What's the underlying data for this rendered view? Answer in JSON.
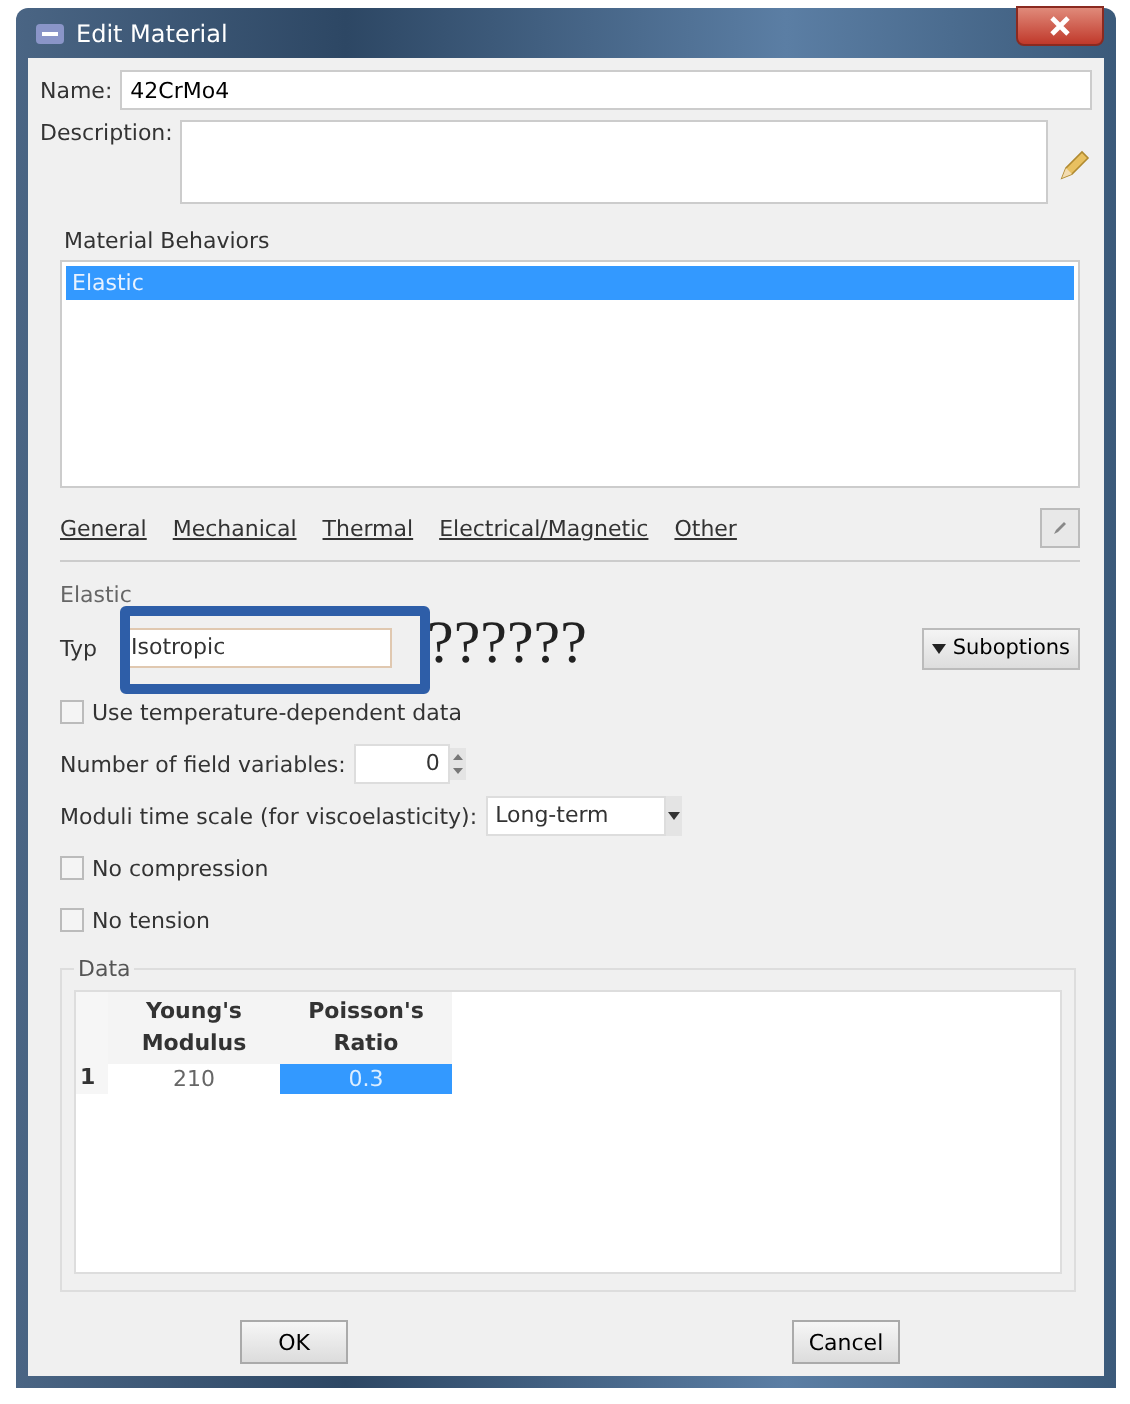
{
  "window": {
    "title": "Edit Material"
  },
  "name": {
    "label": "Name:",
    "value": "42CrMo4"
  },
  "description": {
    "label": "Description:"
  },
  "behaviors": {
    "title": "Material Behaviors",
    "items": [
      {
        "label": "Elastic",
        "selected": true
      }
    ]
  },
  "menus": [
    "General",
    "Mechanical",
    "Thermal",
    "Electrical/Magnetic",
    "Other"
  ],
  "section": "Elastic",
  "type": {
    "label": "Typ",
    "value": "Isotropic",
    "annotation": "??????"
  },
  "suboptions": "Suboptions",
  "options": [
    {
      "kind": "checkbox",
      "label": "Use temperature-dependent data",
      "checked": false
    },
    {
      "kind": "spin",
      "label": "Number of field variables:",
      "value": "0"
    },
    {
      "kind": "combo",
      "label": "Moduli time scale (for viscoelasticity):",
      "value": "Long-term"
    },
    {
      "kind": "checkbox",
      "label": "No compression",
      "checked": false
    },
    {
      "kind": "checkbox",
      "label": "No tension",
      "checked": false
    }
  ],
  "data": {
    "title": "Data",
    "columns": [
      "Young's Modulus",
      "Poisson's Ratio"
    ],
    "rows": [
      {
        "index": "1",
        "cells": [
          {
            "value": "210",
            "selected": false
          },
          {
            "value": "0.3",
            "selected": true
          }
        ]
      }
    ]
  },
  "buttons": [
    "OK",
    "Cancel"
  ]
}
